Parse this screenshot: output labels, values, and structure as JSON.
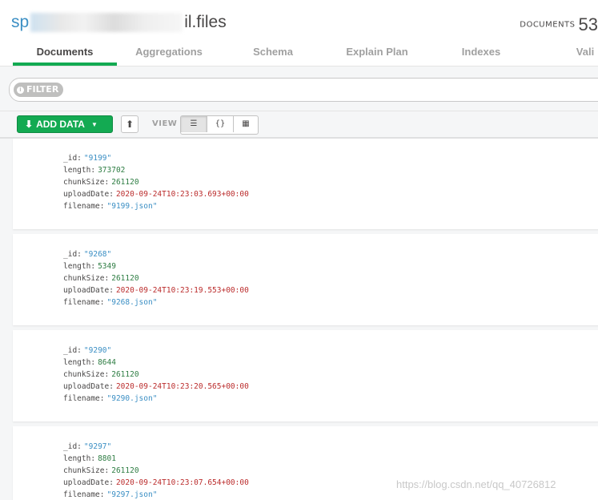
{
  "header": {
    "namespace_db": "sp",
    "namespace_collection": "il.files",
    "doc_count_label": "DOCUMENTS",
    "doc_count_value": "53"
  },
  "tabs": [
    {
      "label": "Documents",
      "active": true
    },
    {
      "label": "Aggregations"
    },
    {
      "label": "Schema"
    },
    {
      "label": "Explain Plan"
    },
    {
      "label": "Indexes"
    },
    {
      "label": "Vali"
    }
  ],
  "filter": {
    "label": "FILTER",
    "icon": "info-icon"
  },
  "toolbar": {
    "add_data_label": "ADD DATA",
    "add_data_icon": "download-icon",
    "export_icon": "export-icon",
    "view_label": "VIEW",
    "views": [
      {
        "icon": "list-view-icon",
        "glyph": "☰",
        "active": true
      },
      {
        "icon": "json-view-icon",
        "glyph": "{}"
      },
      {
        "icon": "table-view-icon",
        "glyph": "▦"
      }
    ]
  },
  "documents": [
    {
      "_id": "\"9199\"",
      "length": "373702",
      "chunkSize": "261120",
      "uploadDate": "2020-09-24T10:23:03.693+00:00",
      "filename": "\"9199.json\""
    },
    {
      "_id": "\"9268\"",
      "length": "5349",
      "chunkSize": "261120",
      "uploadDate": "2020-09-24T10:23:19.553+00:00",
      "filename": "\"9268.json\""
    },
    {
      "_id": "\"9290\"",
      "length": "8644",
      "chunkSize": "261120",
      "uploadDate": "2020-09-24T10:23:20.565+00:00",
      "filename": "\"9290.json\""
    },
    {
      "_id": "\"9297\"",
      "length": "8801",
      "chunkSize": "261120",
      "uploadDate": "2020-09-24T10:23:07.654+00:00",
      "filename": "\"9297.json\""
    }
  ],
  "field_keys": {
    "id": "_id",
    "length": "length",
    "chunkSize": "chunkSize",
    "uploadDate": "uploadDate",
    "filename": "filename",
    "colon": ":"
  },
  "watermark": "https://blog.csdn.net/qq_40726812",
  "colors": {
    "accent": "#13aa52",
    "string": "#3b8fc4",
    "number": "#2e7d43",
    "date": "#bb2d2d"
  }
}
